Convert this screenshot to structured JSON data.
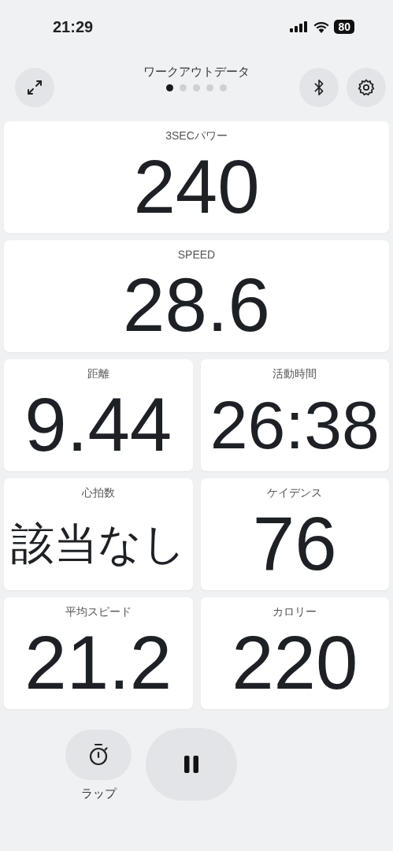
{
  "status_bar": {
    "time": "21:29",
    "battery": "80"
  },
  "header": {
    "title": "ワークアウトデータ",
    "pages": [
      {
        "selected": true
      },
      {
        "selected": false
      },
      {
        "selected": false
      },
      {
        "selected": false
      },
      {
        "selected": false
      }
    ]
  },
  "metrics": [
    {
      "label": "3SECパワー",
      "value": "240",
      "kind": "full"
    },
    {
      "label": "SPEED",
      "value": "28.6",
      "kind": "full"
    },
    {
      "label": "距離",
      "value": "9.44",
      "kind": "half"
    },
    {
      "label": "活動時間",
      "value": "26:38",
      "kind": "half"
    },
    {
      "label": "心拍数",
      "value": "該当なし",
      "kind": "half"
    },
    {
      "label": "ケイデンス",
      "value": "76",
      "kind": "half"
    },
    {
      "label": "平均スピード",
      "value": "21.2",
      "kind": "half"
    },
    {
      "label": "カロリー",
      "value": "220",
      "kind": "half"
    }
  ],
  "controls": {
    "lap_label": "ラップ"
  }
}
